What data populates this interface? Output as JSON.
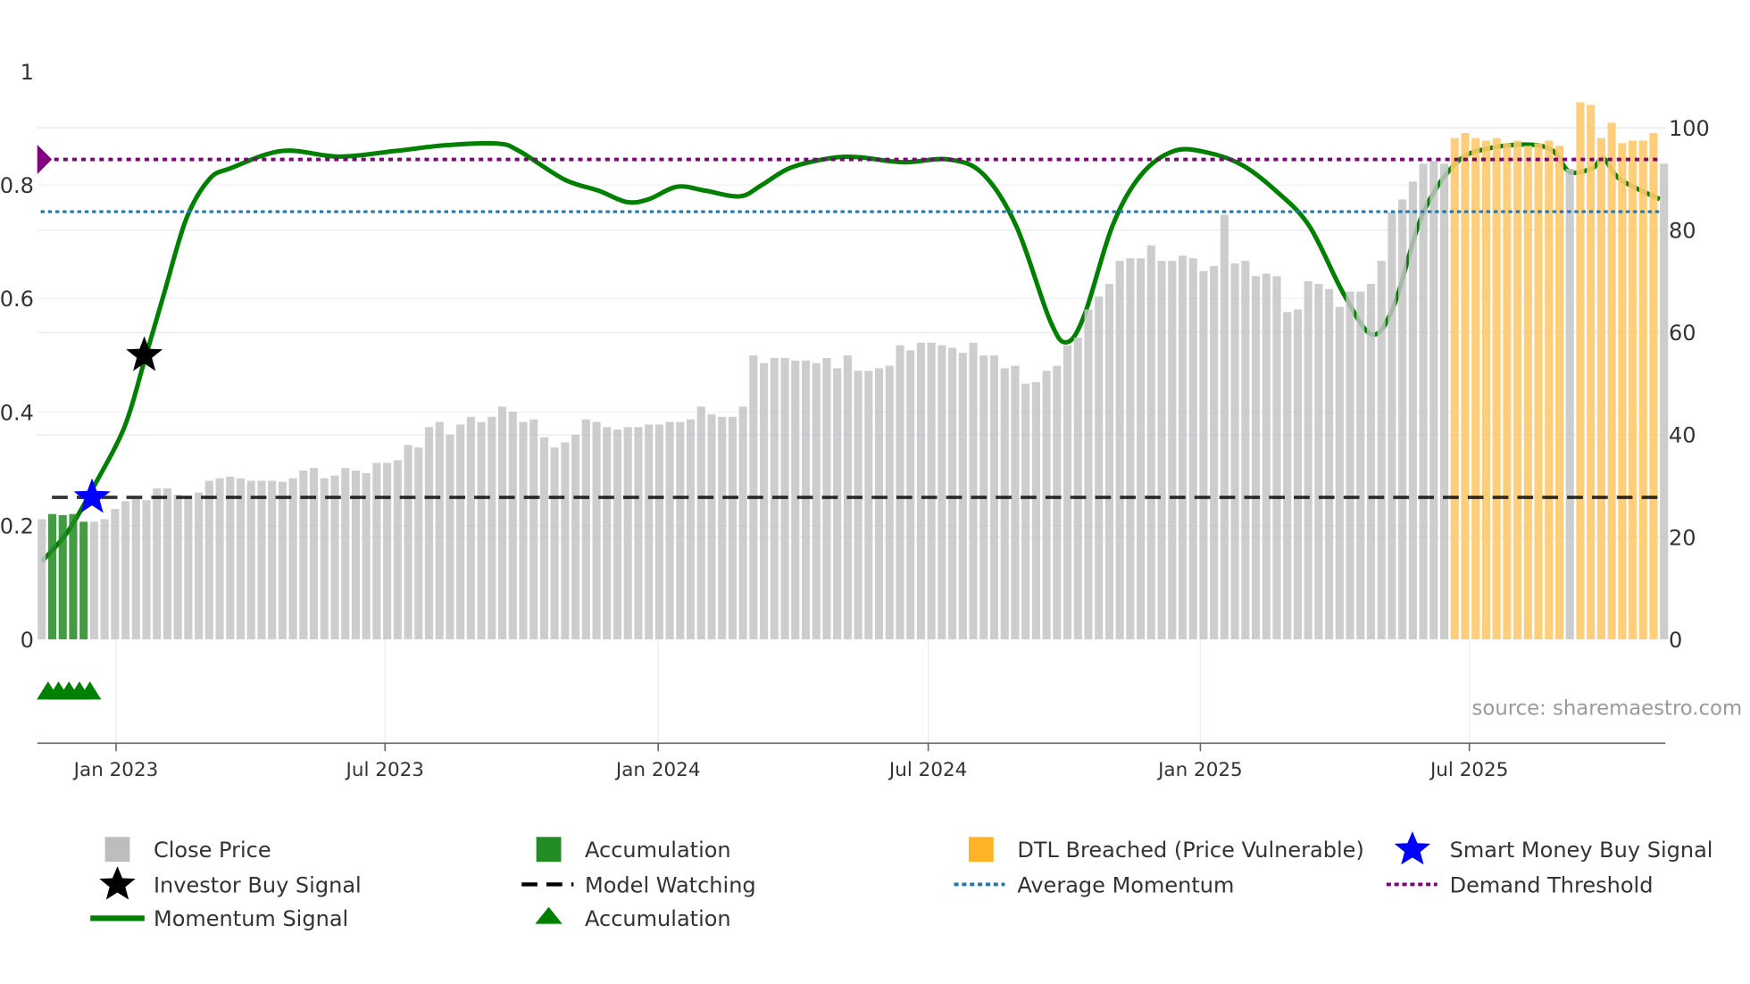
{
  "chart_data": {
    "type": "bar",
    "title": "",
    "x_ticks": [
      {
        "label": "Jan 2023",
        "week": 7.1
      },
      {
        "label": "Jul 2023",
        "week": 32.8
      },
      {
        "label": "Jan 2024",
        "week": 58.9
      },
      {
        "label": "Jul 2024",
        "week": 84.7
      },
      {
        "label": "Jan 2025",
        "week": 110.7
      },
      {
        "label": "Jul 2025",
        "week": 136.4
      }
    ],
    "y_left": {
      "ylim": [
        0,
        1
      ],
      "ticks": [
        "0",
        "0.2",
        "0.4",
        "0.6",
        "0.8",
        "1"
      ]
    },
    "y_right": {
      "ylim": [
        0,
        111
      ],
      "ticks": [
        "0",
        "20",
        "40",
        "60",
        "80",
        "100"
      ]
    },
    "close_price": [
      23.5,
      24.5,
      24.3,
      24.5,
      23,
      23,
      23.5,
      25.5,
      27,
      27.5,
      27.2,
      29.5,
      29.5,
      28.3,
      28,
      28.7,
      31,
      31.5,
      31.8,
      31.5,
      31,
      31,
      31,
      30.8,
      31.5,
      33,
      33.5,
      31.5,
      32,
      33.5,
      33,
      32.5,
      34.5,
      34.5,
      35,
      38,
      37.5,
      41.5,
      42.5,
      40,
      42,
      43.5,
      42.5,
      43.5,
      45.5,
      44.5,
      42.5,
      43,
      39.5,
      37.5,
      38.5,
      40,
      43,
      42.5,
      41.5,
      41,
      41.5,
      41.5,
      42,
      42,
      42.5,
      42.5,
      43,
      45.5,
      44,
      43.5,
      43.5,
      45.5,
      55.5,
      54,
      55,
      55,
      54.5,
      54.5,
      54,
      55,
      53,
      55.5,
      52.5,
      52.5,
      53,
      53.5,
      57.5,
      56.5,
      58,
      58,
      57.5,
      57,
      56,
      58,
      55.5,
      55.5,
      53,
      53.5,
      50,
      50.3,
      52.5,
      53.5,
      57.5,
      59,
      64.5,
      67,
      69.5,
      74,
      74.5,
      74.5,
      77,
      74,
      74,
      75,
      74.5,
      72,
      73,
      83,
      73.5,
      74,
      71,
      71.5,
      71,
      64,
      64.5,
      70,
      69.5,
      68.5,
      65,
      68,
      68,
      69.5,
      74,
      83.5,
      86,
      89.5,
      93,
      93.5,
      93,
      98,
      99,
      98,
      97.5,
      98,
      97,
      97.5,
      96.5,
      97,
      97.5,
      96.5,
      92,
      105,
      104.5,
      98,
      101,
      97,
      97.5,
      97.5,
      99,
      93
    ],
    "accumulation_bars": [
      1,
      2,
      3,
      4
    ],
    "dtl_breached_bars": [
      135,
      136,
      137,
      138,
      139,
      140,
      141,
      142,
      143,
      144,
      145,
      147,
      148,
      149,
      150,
      151,
      152,
      153,
      154
    ],
    "momentum_signal": [
      [
        0,
        0.137
      ],
      [
        2.5,
        0.19
      ],
      [
        5,
        0.27
      ],
      [
        7.9,
        0.374
      ],
      [
        9.8,
        0.49
      ],
      [
        11.7,
        0.61
      ],
      [
        13.8,
        0.74
      ],
      [
        16,
        0.81
      ],
      [
        18.1,
        0.83
      ],
      [
        23,
        0.86
      ],
      [
        28.4,
        0.85
      ],
      [
        33.8,
        0.86
      ],
      [
        38.6,
        0.87
      ],
      [
        43.5,
        0.873
      ],
      [
        45.6,
        0.86
      ],
      [
        49.9,
        0.81
      ],
      [
        53.2,
        0.79
      ],
      [
        55.9,
        0.77
      ],
      [
        58,
        0.775
      ],
      [
        60.7,
        0.797
      ],
      [
        63.4,
        0.79
      ],
      [
        66.7,
        0.78
      ],
      [
        68.8,
        0.8
      ],
      [
        71.5,
        0.83
      ],
      [
        75.3,
        0.847
      ],
      [
        78,
        0.849
      ],
      [
        82.3,
        0.84
      ],
      [
        86.6,
        0.845
      ],
      [
        89.9,
        0.82
      ],
      [
        93.1,
        0.728
      ],
      [
        96.3,
        0.563
      ],
      [
        97.9,
        0.523
      ],
      [
        99.6,
        0.57
      ],
      [
        102.3,
        0.728
      ],
      [
        105,
        0.817
      ],
      [
        108.2,
        0.86
      ],
      [
        111.4,
        0.857
      ],
      [
        114.7,
        0.835
      ],
      [
        117.9,
        0.79
      ],
      [
        121.1,
        0.728
      ],
      [
        124.4,
        0.608
      ],
      [
        127.1,
        0.537
      ],
      [
        129.2,
        0.588
      ],
      [
        131.9,
        0.747
      ],
      [
        135.2,
        0.84
      ],
      [
        138.4,
        0.865
      ],
      [
        142.2,
        0.871
      ],
      [
        144.4,
        0.86
      ],
      [
        146,
        0.823
      ],
      [
        148.2,
        0.83
      ],
      [
        149.2,
        0.847
      ],
      [
        150.8,
        0.81
      ],
      [
        154.6,
        0.775
      ]
    ],
    "demand_threshold": 0.845,
    "average_momentum": 0.753,
    "model_watching": 0.25,
    "smart_money_buy_signal": [
      [
        4.8,
        0.25
      ]
    ],
    "investor_buy_signal": [
      [
        9.8,
        0.5
      ]
    ],
    "accumulation_markers": [
      [
        0.6,
        -0.09
      ],
      [
        1.6,
        -0.09
      ],
      [
        2.6,
        -0.09
      ],
      [
        3.6,
        -0.09
      ],
      [
        4.6,
        -0.09
      ]
    ],
    "colors": {
      "close": "#c4c4c4",
      "accumulation": "#228b22",
      "dtl": "#ffc96b",
      "momentum": "#008000",
      "demand": "#800080",
      "average": "#1f77b4",
      "watching": "#000000",
      "smart": "#0000ff",
      "investor": "#000000"
    },
    "legend": {
      "close_price": "Close Price",
      "accumulation_bar": "Accumulation",
      "dtl": "DTL Breached (Price Vulnerable)",
      "smart_money": "Smart Money Buy Signal",
      "investor": "Investor Buy Signal",
      "model_watching": "Model Watching",
      "average_momentum": "Average Momentum",
      "demand_threshold": "Demand Threshold",
      "momentum": "Momentum Signal",
      "accumulation_marker": "Accumulation"
    },
    "source": "source: sharemaestro.com"
  }
}
